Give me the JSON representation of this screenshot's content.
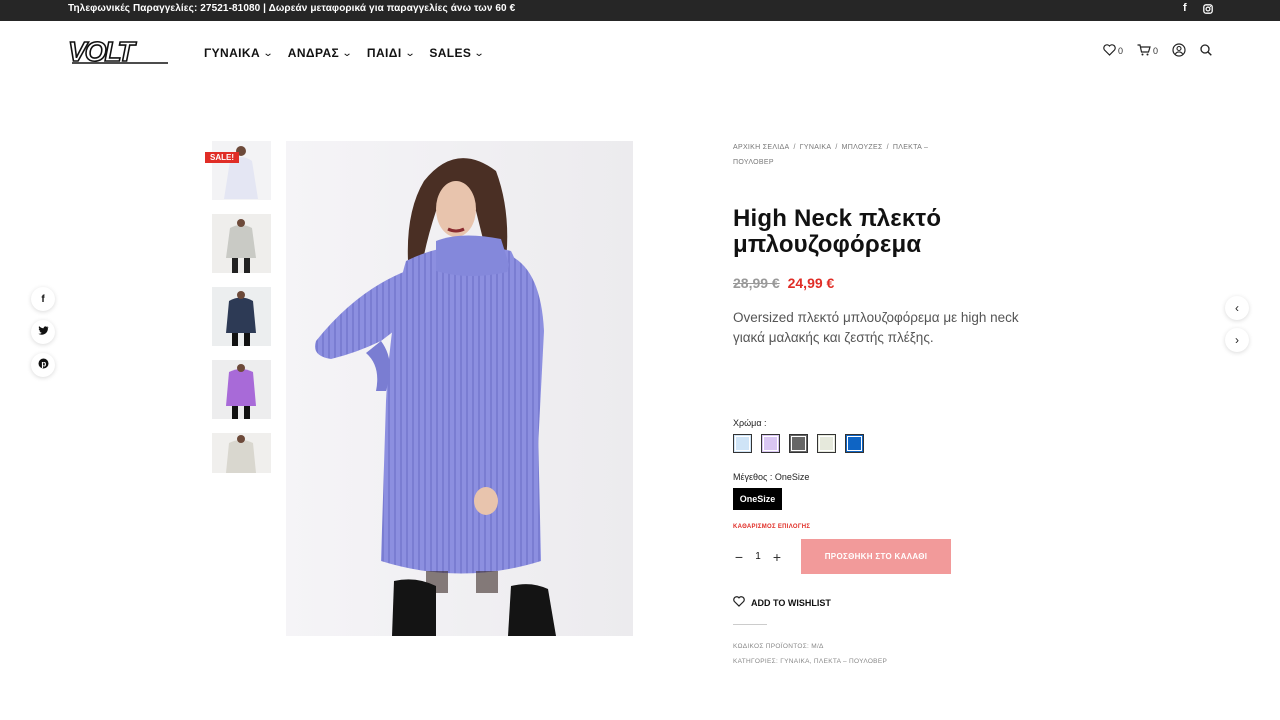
{
  "topbar": {
    "text": "Τηλεφωνικές Παραγγελίες: 27521-81080 | Δωρεάν μεταφορικά για παραγγελίες άνω των 60 €",
    "facebook_glyph": "f",
    "instagram_icon": "instagram-icon"
  },
  "header": {
    "logo_text": "VOLT",
    "nav": [
      {
        "label": "ΓΥΝΑΙΚΑ"
      },
      {
        "label": "ΑΝΔΡΑΣ"
      },
      {
        "label": "ΠΑΙΔΙ"
      },
      {
        "label": "SALES"
      }
    ],
    "chevron_glyph": "⌄",
    "wishlist_count": "0",
    "cart_count": "0"
  },
  "share": {
    "facebook_glyph": "f",
    "twitter_icon": "twitter-icon",
    "pinterest_icon": "pinterest-icon"
  },
  "gallery": {
    "sale_badge": "SALE!",
    "thumbnails": [
      {
        "color": "lavender-light"
      },
      {
        "color": "grey"
      },
      {
        "color": "navy"
      },
      {
        "color": "lilac"
      },
      {
        "color": "cream"
      }
    ]
  },
  "product": {
    "breadcrumb": [
      "ΑΡΧΙΚΗ ΣΕΛΙΔΑ",
      "ΓΥΝΑΙΚΑ",
      "ΜΠΛΟΥΖΕΣ",
      "ΠΛΕΚΤΑ –",
      "ΠΟΥΛΟΒΕΡ"
    ],
    "breadcrumb_sep": "/",
    "title": "High Neck πλεκτό μπλουζοφόρεμα",
    "old_price": "28,99 €",
    "new_price": "24,99 €",
    "description": "Oversized πλεκτό μπλουζοφόρεμα με high neck γιακά μαλακής και ζεστής πλέξης.",
    "color_label": "Χρώμα :",
    "colors": [
      "#cfe4f7",
      "#d9c6f3",
      "#666666",
      "#e6e9dc",
      "#0e64c4"
    ],
    "size_label": "Μέγεθος : OneSize",
    "size_value": "OneSize",
    "clear_label": "ΚΑΘΑΡΙΣΜΟΣ ΕΠΙΛΟΓΗΣ",
    "quantity": "1",
    "minus_glyph": "−",
    "plus_glyph": "+",
    "add_to_cart": "ΠΡΟΣΘΗΚΗ ΣΤΟ ΚΑΛΑΘΙ",
    "wishlist_label": "ADD TO WISHLIST",
    "sku": "ΚΩΔΙΚΟΣ ΠΡΟΪΟΝΤΟΣ: Μ/Δ",
    "categories": "ΚΑΤΗΓΟΡΙΕΣ: ΓΥΝΑΙΚΑ, ΠΛΕΚΤΑ – ΠΟΥΛΟΒΕΡ"
  },
  "pager": {
    "prev_glyph": "‹",
    "next_glyph": "›"
  },
  "colors": {
    "accent_red": "#e02d26",
    "add_cart_bg": "#f29a9a",
    "topbar_bg": "#262626"
  }
}
